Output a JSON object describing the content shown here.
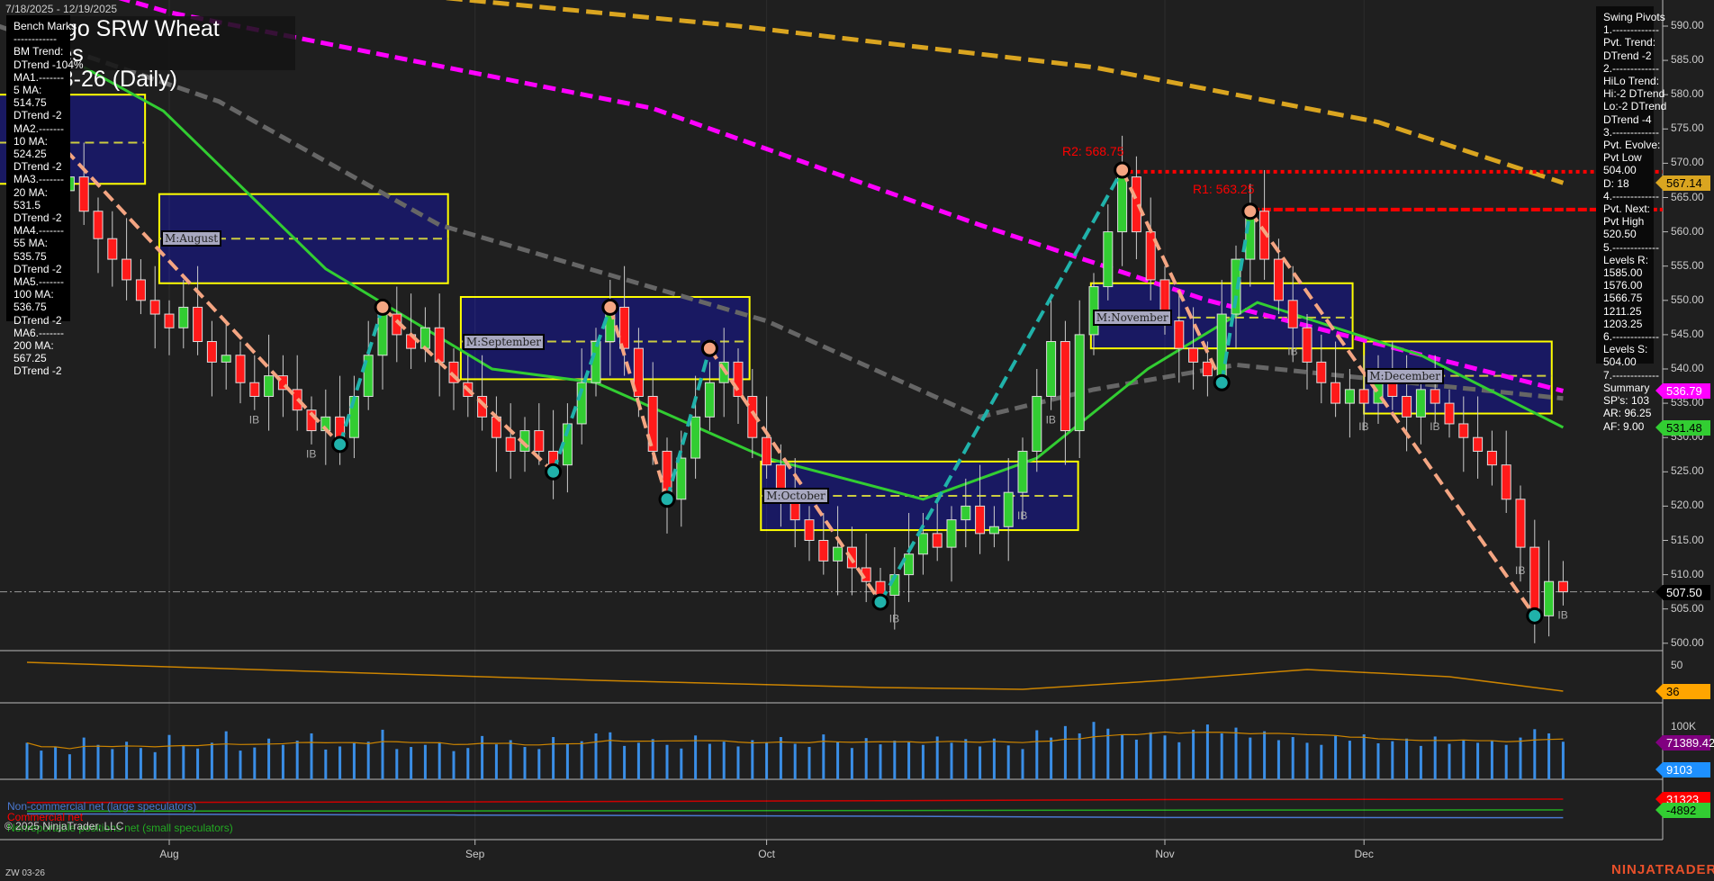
{
  "header": {
    "date_range": "7/18/2025 - 12/19/2025",
    "title_line1": "Chicago SRW Wheat Futures",
    "title_line2": "ZW 03-26 (Daily)"
  },
  "bench_marks": [
    "Bench Marks",
    "------------",
    "BM Trend:",
    "DTrend -104%",
    "MA1.-------",
    "5 MA:",
    "514.75",
    "DTrend -2",
    "MA2.-------",
    "10 MA:",
    "524.25",
    "DTrend -2",
    "MA3.-------",
    "20 MA:",
    "531.5",
    "DTrend -2",
    "MA4.-------",
    "55 MA:",
    "535.75",
    "DTrend -2",
    "MA5.-------",
    "100 MA:",
    "536.75",
    "DTrend -2",
    "MA6.-------",
    "200 MA:",
    "567.25",
    "DTrend -2"
  ],
  "swing_pivots": [
    "Swing Pivots",
    "1.-------------",
    "Pvt. Trend:",
    "DTrend -2",
    "2.-------------",
    "HiLo Trend:",
    "Hi:-2 DTrend",
    "Lo:-2 DTrend",
    "DTrend -4",
    "3.-------------",
    "Pvt. Evolve:",
    "Pvt Low",
    "504.00",
    "D: 18",
    "4.-------------",
    "Pvt. Next:",
    "Pvt High",
    "520.50",
    "5.-------------",
    "Levels R:",
    "1585.00",
    "1576.00",
    "1566.75",
    "1211.25",
    "1203.25",
    "6.-------------",
    "Levels S:",
    "504.00",
    "7.-------------",
    "Summary",
    "SP's: 103",
    "AR: 96.25",
    "AF: 9.00"
  ],
  "levels": {
    "r2": "R2: 568.75",
    "r1": "R1: 563.25",
    "r2_value": 568.75,
    "r1_value": 563.25,
    "last": 507.5
  },
  "price_axis": [
    "590.00",
    "585.00",
    "580.00",
    "575.00",
    "570.00",
    "565.00",
    "560.00",
    "555.00",
    "550.00",
    "545.00",
    "540.00",
    "535.00",
    "530.00",
    "525.00",
    "520.00",
    "515.00",
    "510.00",
    "505.00",
    "500.00"
  ],
  "price_tags": [
    {
      "text": "567.14",
      "value": 567.14,
      "bg": "#daa520",
      "fg": "#000"
    },
    {
      "text": "536.79",
      "value": 536.79,
      "bg": "#ff00ff",
      "fg": "#fff"
    },
    {
      "text": "531.48",
      "value": 531.48,
      "bg": "#32cd32",
      "fg": "#000"
    },
    {
      "text": "507.50",
      "value": 507.5,
      "bg": "#000000",
      "fg": "#fff"
    }
  ],
  "osc": {
    "axis": [
      "50"
    ],
    "tag": "36",
    "tag_color": "#ffa500"
  },
  "volume": {
    "axis": "100K",
    "tag1": "71389.42",
    "tag1_color": "#800080",
    "tag2": "9103",
    "tag2_color": "#1e90ff"
  },
  "cot": {
    "tag1": "31323",
    "tag1_color": "#ff0000",
    "tag2": "-4892",
    "tag2_color": "#32cd32",
    "legend": [
      {
        "text": "Non-commercial net (large speculators)",
        "color": "#4a78d0"
      },
      {
        "text": "Commercial net",
        "color": "#ff0000"
      },
      {
        "text": "Nonreportable positions net (small speculators)",
        "color": "#22aa22"
      }
    ]
  },
  "months": [
    {
      "label": "Aug",
      "index": 10
    },
    {
      "label": "Sep",
      "index": 31.5
    },
    {
      "label": "Oct",
      "index": 52
    },
    {
      "label": "Nov",
      "index": 80
    },
    {
      "label": "Dec",
      "index": 94
    }
  ],
  "monthly_boxes": [
    {
      "label": "",
      "from": -2,
      "to": 8.3,
      "hi": 580,
      "lo": 567,
      "mid": 573
    },
    {
      "label": "M:August",
      "from": 9.3,
      "to": 29.6,
      "hi": 565.5,
      "lo": 552.5,
      "mid": 559
    },
    {
      "label": "M:September",
      "from": 30.5,
      "to": 50.8,
      "hi": 550.5,
      "lo": 538.5,
      "mid": 544
    },
    {
      "label": "M:October",
      "from": 51.6,
      "to": 73.9,
      "hi": 526.5,
      "lo": 516.5,
      "mid": 521.5
    },
    {
      "label": "M:November",
      "from": 74.8,
      "to": 93.2,
      "hi": 552.5,
      "lo": 543,
      "mid": 547.5
    },
    {
      "label": "M:December",
      "from": 94,
      "to": 107.2,
      "hi": 544,
      "lo": 533.5,
      "mid": 539
    }
  ],
  "ib_marks": [
    16,
    20,
    61,
    70,
    72,
    89,
    94,
    99,
    105,
    108
  ],
  "instrument": "ZW 03-26",
  "copyright": "© 2025 NinjaTrader, LLC",
  "logo": "NINJATRADER",
  "chart_data": {
    "type": "candlestick",
    "closes": [
      574,
      571,
      566,
      568,
      563,
      559,
      556,
      553,
      550,
      548,
      546,
      549,
      544,
      541,
      542,
      538,
      536,
      539,
      537,
      534,
      531,
      533,
      530,
      536,
      542,
      548,
      545,
      543,
      546,
      541,
      538,
      536,
      533,
      530,
      528,
      531,
      528,
      526,
      532,
      538,
      544,
      549,
      543,
      536,
      528,
      521,
      527,
      533,
      538,
      541,
      536,
      530,
      526,
      522,
      518,
      515,
      512,
      514,
      511,
      509,
      507,
      510,
      513,
      516,
      514,
      518,
      520,
      516,
      517,
      522,
      528,
      536,
      544,
      531,
      545,
      552,
      560,
      568,
      560,
      553,
      547,
      543,
      541,
      539,
      548,
      556,
      563,
      556,
      550,
      546,
      541,
      538,
      535,
      537,
      535,
      540,
      536,
      533,
      537,
      535,
      532,
      530,
      528,
      526,
      521,
      514,
      504,
      509,
      507.5
    ],
    "volume_k": [
      70,
      55,
      62,
      48,
      80,
      66,
      58,
      72,
      60,
      52,
      85,
      64,
      59,
      70,
      92,
      55,
      61,
      78,
      66,
      74,
      88,
      57,
      63,
      69,
      72,
      95,
      58,
      62,
      66,
      71,
      54,
      60,
      83,
      67,
      75,
      62,
      58,
      81,
      69,
      73,
      88,
      90,
      64,
      70,
      77,
      66,
      59,
      84,
      68,
      72,
      63,
      75,
      70,
      81,
      68,
      62,
      86,
      72,
      60,
      79,
      67,
      74,
      71,
      66,
      82,
      70,
      77,
      63,
      78,
      65,
      58,
      94,
      80,
      102,
      88,
      110,
      97,
      85,
      76,
      90,
      84,
      71,
      95,
      105,
      88,
      99,
      80,
      92,
      75,
      81,
      70,
      66,
      83,
      74,
      86,
      69,
      73,
      78,
      64,
      82,
      68,
      76,
      70,
      74,
      66,
      80,
      96,
      88,
      72
    ],
    "ma200": [
      [
        0,
        600
      ],
      [
        20,
        596
      ],
      [
        50,
        590
      ],
      [
        75,
        584
      ],
      [
        95,
        576
      ],
      [
        108,
        567.14
      ]
    ],
    "ma100": [
      [
        0,
        598
      ],
      [
        10,
        592
      ],
      [
        44,
        578
      ],
      [
        67,
        561
      ],
      [
        83,
        550
      ],
      [
        108,
        536.79
      ]
    ],
    "ma55": [
      [
        -2,
        590
      ],
      [
        13.5,
        579
      ],
      [
        29,
        561
      ],
      [
        52,
        547
      ],
      [
        67,
        533
      ],
      [
        75,
        537
      ],
      [
        85,
        540.6
      ],
      [
        108,
        535.7
      ]
    ],
    "ma20": [
      [
        4,
        584
      ],
      [
        9.6,
        577.6
      ],
      [
        21,
        554.6
      ],
      [
        32.7,
        540
      ],
      [
        40,
        538
      ],
      [
        52,
        527
      ],
      [
        63,
        521
      ],
      [
        71,
        527
      ],
      [
        78.8,
        540
      ],
      [
        86.5,
        549.7
      ],
      [
        98,
        542
      ],
      [
        108,
        531.48
      ]
    ],
    "swing_pivots": [
      [
        0,
        578
      ],
      [
        22,
        529
      ],
      [
        25,
        549
      ],
      [
        37,
        525
      ],
      [
        41,
        549
      ],
      [
        45,
        521
      ],
      [
        48,
        543
      ],
      [
        60,
        506
      ],
      [
        77,
        569
      ],
      [
        84,
        538
      ],
      [
        86,
        563
      ],
      [
        106,
        504
      ]
    ],
    "oscillator": [
      [
        0,
        52
      ],
      [
        20,
        47
      ],
      [
        40,
        42
      ],
      [
        60,
        38
      ],
      [
        70,
        37
      ],
      [
        80,
        42
      ],
      [
        90,
        48
      ],
      [
        100,
        44
      ],
      [
        108,
        36
      ]
    ],
    "cot_commercial": [
      [
        0,
        20000
      ],
      [
        30,
        22000
      ],
      [
        60,
        26000
      ],
      [
        80,
        30000
      ],
      [
        108,
        31323
      ]
    ],
    "cot_nonreportable": [
      [
        0,
        -9000
      ],
      [
        40,
        -8000
      ],
      [
        80,
        -5500
      ],
      [
        108,
        -4892
      ]
    ],
    "cot_noncommercial": [
      [
        0,
        -18000
      ],
      [
        30,
        -22000
      ],
      [
        60,
        -26000
      ],
      [
        80,
        -30000
      ],
      [
        108,
        -31000
      ]
    ],
    "ylim": [
      500,
      590
    ]
  }
}
